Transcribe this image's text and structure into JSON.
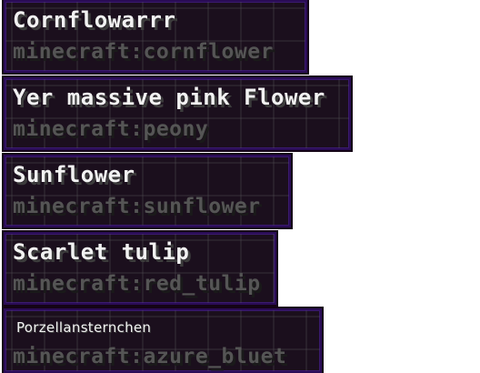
{
  "tooltips": [
    {
      "name": "Cornflowarrr",
      "registry_id": "minecraft:cornflower"
    },
    {
      "name": "Yer massive pink Flower",
      "registry_id": "minecraft:peony"
    },
    {
      "name": "Sunflower",
      "registry_id": "minecraft:sunflower"
    },
    {
      "name": "Scarlet tulip",
      "registry_id": "minecraft:red_tulip"
    },
    {
      "name": "Porzellansternchen",
      "registry_id": "minecraft:azure_bluet"
    }
  ],
  "colors": {
    "tooltip_background": "#120514",
    "tooltip_border": "#2a0c56",
    "name_text": "#f2f2f2",
    "registry_id_text": "#555555"
  }
}
